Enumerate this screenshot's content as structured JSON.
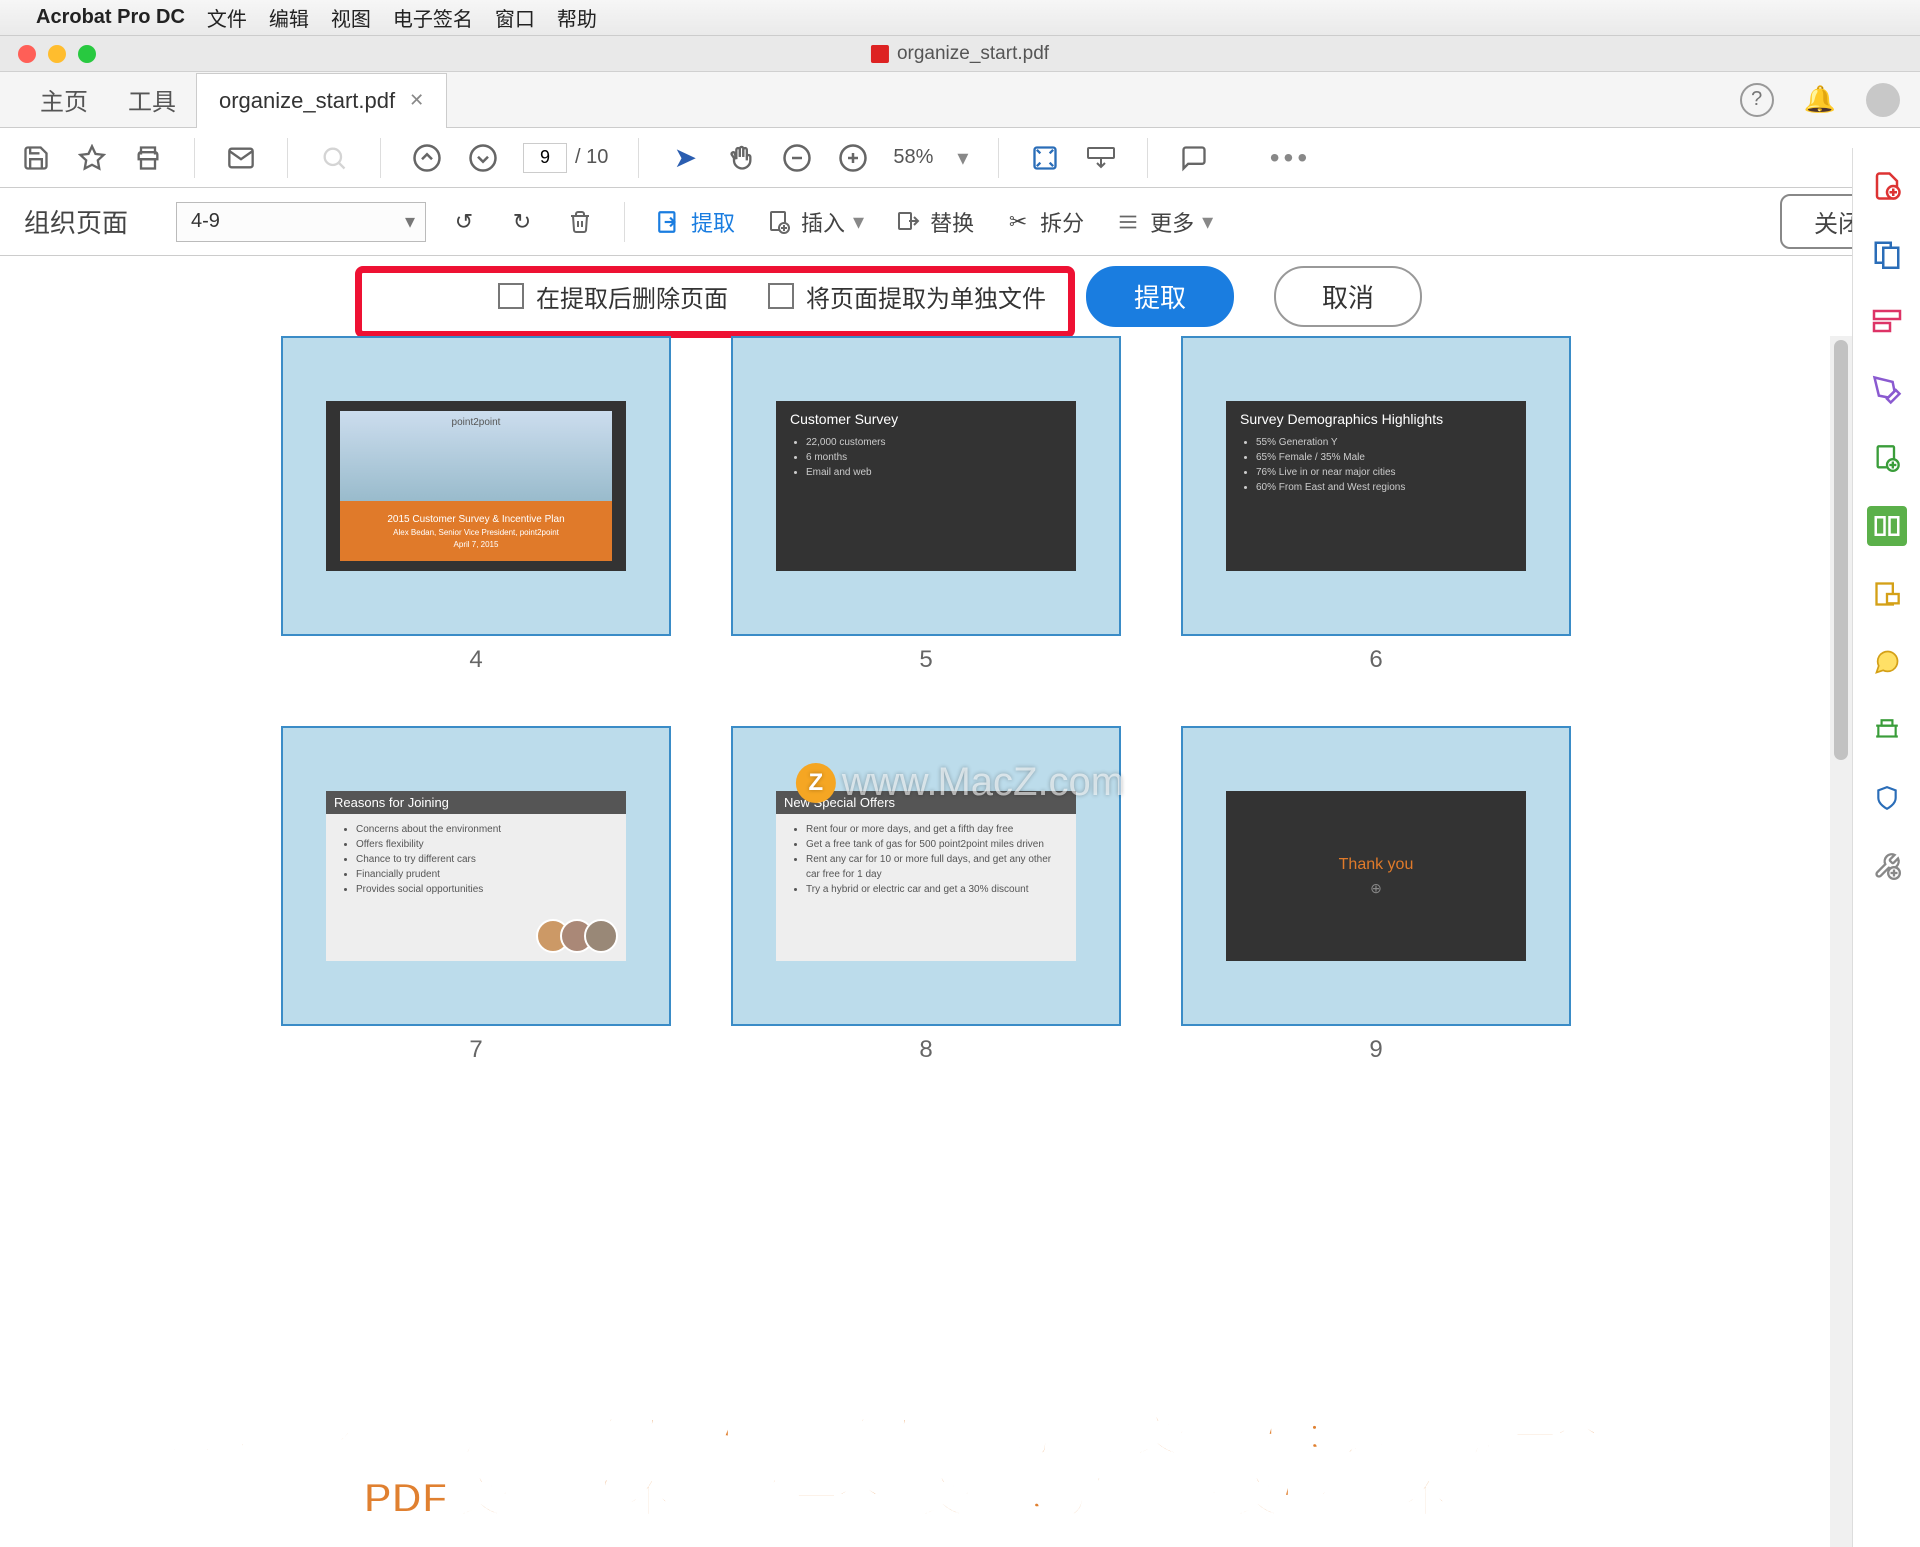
{
  "mac_menu": {
    "apple": "",
    "app": "Acrobat Pro DC",
    "items": [
      "文件",
      "编辑",
      "视图",
      "电子签名",
      "窗口",
      "帮助"
    ]
  },
  "window": {
    "title": "organize_start.pdf"
  },
  "tabs": {
    "home": "主页",
    "tools": "工具",
    "file": "organize_start.pdf"
  },
  "toolbar": {
    "page_current": "9",
    "page_total": "/ 10",
    "zoom": "58%"
  },
  "organize": {
    "title": "组织页面",
    "range": "4-9",
    "extract": "提取",
    "insert": "插入",
    "replace": "替换",
    "split": "拆分",
    "more": "更多",
    "close": "关闭"
  },
  "extract_opts": {
    "delete_after": "在提取后删除页面",
    "as_separate": "将页面提取为单独文件",
    "extract_btn": "提取",
    "cancel_btn": "取消"
  },
  "watermark": {
    "text": "www.MacZ.com",
    "badge": "Z"
  },
  "slides": [
    {
      "num": "4",
      "type": "first",
      "brand": "point2point",
      "title1": "2015 Customer Survey & Incentive Plan",
      "sub": "Alex Bedan, Senior Vice President, point2point",
      "date": "April 7, 2015"
    },
    {
      "num": "5",
      "type": "dark",
      "title": "Customer Survey",
      "bullets": [
        "22,000 customers",
        "6 months",
        "Email and web"
      ]
    },
    {
      "num": "6",
      "type": "dark",
      "title": "Survey Demographics Highlights",
      "bullets": [
        "55% Generation Y",
        "65% Female / 35% Male",
        "76% Live in or near major cities",
        "60% From East and West regions"
      ]
    },
    {
      "num": "7",
      "type": "white",
      "title": "Reasons for Joining",
      "bullets": [
        "Concerns about the environment",
        "Offers flexibility",
        "Chance to try different cars",
        "Financially prudent",
        "Provides social opportunities"
      ]
    },
    {
      "num": "8",
      "type": "white",
      "title": "New Special Offers",
      "bullets": [
        "Rent four or more days, and get a fifth day free",
        "Get a free tank of gas for 500 point2point miles driven",
        "Rent any car for 10 or more full days, and get any other car free for 1 day",
        "Try a hybrid or electric car and get a 30% discount"
      ]
    },
    {
      "num": "9",
      "type": "thanks",
      "title": "Thank you"
    }
  ],
  "annotation": {
    "line1": "未选中「在提取后删除页面」和「将页面提取为单独文件」框；这将生成一个新的",
    "line2": "PDF 文件（而不是每页一个新文件），并且原始文档保持不变"
  }
}
